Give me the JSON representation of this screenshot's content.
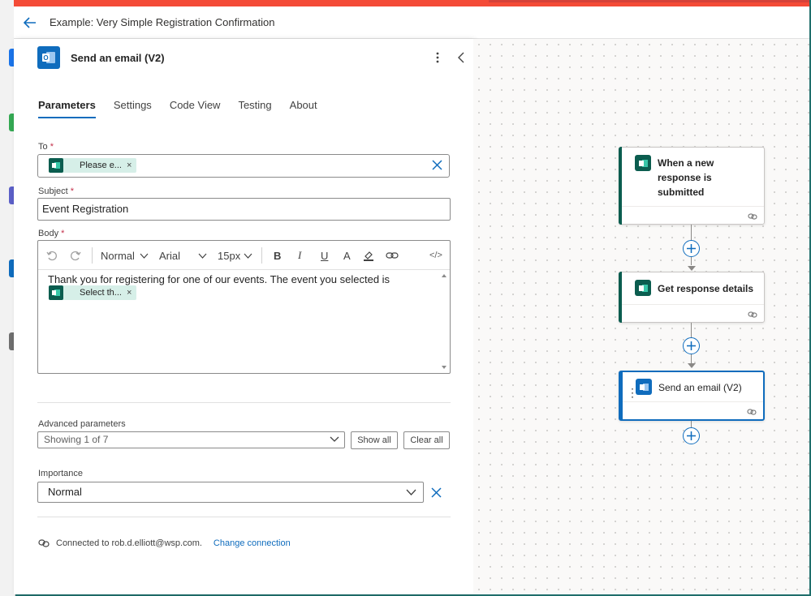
{
  "flow_title": "Example: Very Simple Registration Confirmation",
  "panel": {
    "title": "Send an email (V2)",
    "tabs": [
      {
        "label": "Parameters",
        "active": true
      },
      {
        "label": "Settings",
        "active": false
      },
      {
        "label": "Code View",
        "active": false
      },
      {
        "label": "Testing",
        "active": false
      },
      {
        "label": "About",
        "active": false
      }
    ],
    "to": {
      "label": "To",
      "required": "*",
      "token_text": "Please e...",
      "token_remove": "×"
    },
    "subject": {
      "label": "Subject",
      "required": "*",
      "value": "Event Registration"
    },
    "body": {
      "label": "Body",
      "required": "*",
      "toolbar": {
        "style": "Normal",
        "font": "Arial",
        "size": "15px",
        "bold": "B",
        "italic": "I",
        "underline": "U",
        "font_color": "A",
        "code": "</>"
      },
      "text": "Thank you for registering for one of our events. The event you selected is",
      "token_text": "Select th...",
      "token_remove": "×"
    },
    "advanced": {
      "label": "Advanced parameters",
      "value": "Showing 1 of 7",
      "show_all": "Show all",
      "clear_all": "Clear all"
    },
    "importance": {
      "label": "Importance",
      "value": "Normal"
    },
    "connection": {
      "text": "Connected to rob.d.elliott@wsp.com.",
      "link": "Change connection"
    }
  },
  "canvas": {
    "nodes": [
      {
        "title": "When a new response is submitted",
        "type": "forms"
      },
      {
        "title": "Get response details",
        "type": "forms"
      },
      {
        "title": "Send an email (V2)",
        "type": "outlook",
        "selected": true
      }
    ]
  },
  "colors": {
    "accent": "#0f6cbd",
    "forms": "#0b5d4f",
    "topbar": "#f44b37",
    "required": "#c4314b"
  }
}
